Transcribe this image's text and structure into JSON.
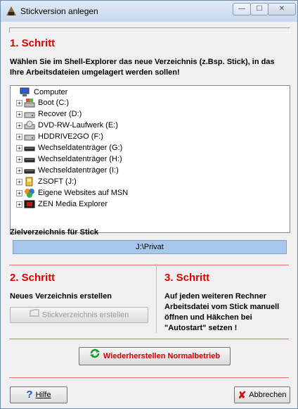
{
  "window": {
    "title": "Stickversion anlegen",
    "controls": {
      "minimize": "—",
      "maximize": "☐",
      "close": "✕"
    }
  },
  "step1": {
    "heading": "1. Schritt",
    "instruction": "Wählen Sie im Shell-Explorer das neue Verzeichnis (z.Bsp. Stick), in das Ihre Arbeitsdateien umgelagert werden sollen!"
  },
  "tree": {
    "items": [
      {
        "label": "Computer",
        "icon": "computer-icon",
        "expander": false
      },
      {
        "label": "Boot (C:)",
        "icon": "drive-os-icon",
        "expander": true
      },
      {
        "label": "Recover (D:)",
        "icon": "hard-drive-icon",
        "expander": true
      },
      {
        "label": "DVD-RW-Laufwerk (E:)",
        "icon": "dvd-drive-icon",
        "expander": true
      },
      {
        "label": "HDDRIVE2GO (F:)",
        "icon": "hard-drive-icon",
        "expander": true
      },
      {
        "label": "Wechseldatenträger (G:)",
        "icon": "removable-drive-icon",
        "expander": true
      },
      {
        "label": "Wechseldatenträger (H:)",
        "icon": "removable-drive-icon",
        "expander": true
      },
      {
        "label": "Wechseldatenträger (I:)",
        "icon": "removable-drive-icon",
        "expander": true
      },
      {
        "label": "ZSOFT (J:)",
        "icon": "usb-drive-icon",
        "expander": true
      },
      {
        "label": "Eigene Websites auf MSN",
        "icon": "msn-icon",
        "expander": true
      },
      {
        "label": "ZEN Media Explorer",
        "icon": "media-icon",
        "expander": true
      }
    ]
  },
  "target": {
    "label": "Zielverzeichnis für Stick",
    "value": "J:\\Privat"
  },
  "step2": {
    "heading": "2. Schritt",
    "text": "Neues Verzeichnis erstellen",
    "button": "Stickverzeichnis erstellen"
  },
  "step3": {
    "heading": "3. Schritt",
    "text1": "Auf jeden weiteren Rechner",
    "text2": "Arbeitsdatei vom Stick manuell",
    "text3": "öffnen und Häkchen bei",
    "text4": "\"Autostart\" setzen !"
  },
  "restore_button": "Wiederherstellen  Normalbetrieb",
  "help_button": "Hilfe",
  "cancel_button": "Abbrechen",
  "colors": {
    "step_heading": "#e00000",
    "selected_target": "#a7c8ec"
  }
}
